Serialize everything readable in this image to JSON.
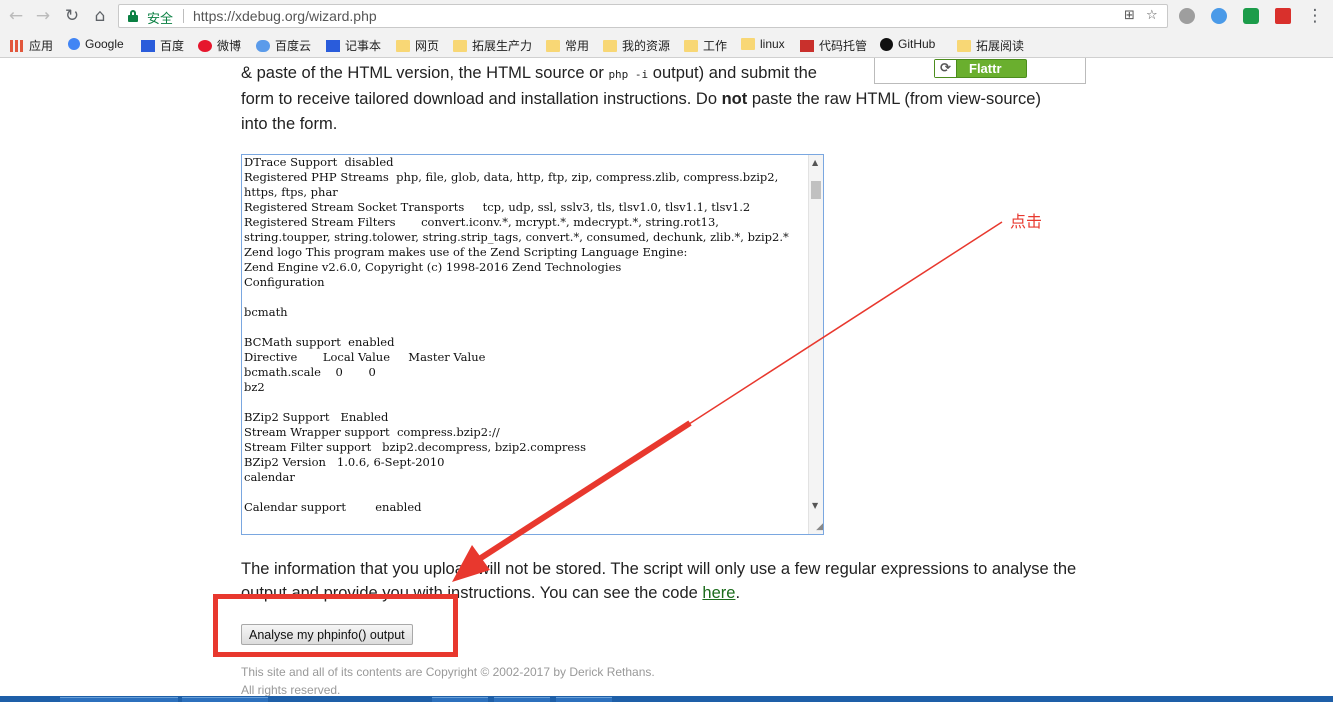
{
  "browser": {
    "secure_label": "安全",
    "url": "https://xdebug.org/wizard.php",
    "bookmarks": [
      "应用",
      "Google",
      "百度",
      "微博",
      "百度云",
      "记事本",
      "网页",
      "拓展生产力",
      "常用",
      "我的资源",
      "工作",
      "linux",
      "代码托管",
      "GitHub",
      "拓展阅读"
    ]
  },
  "page": {
    "intro_line1": "& paste of the HTML version, the HTML source or ",
    "intro_code": "php -i",
    "intro_line1_end": " output) and submit the",
    "intro_line2_pre": "form to receive tailored download and installation instructions. Do ",
    "intro_bold": "not",
    "intro_line2_post": " paste the raw HTML (from view-source)",
    "intro_line3": "into the form.",
    "flattr_label": "Flattr",
    "phpinfo_text": "DTrace Support  disabled\nRegistered PHP Streams  php, file, glob, data, http, ftp, zip, compress.zlib, compress.bzip2, https, ftps, phar\nRegistered Stream Socket Transports     tcp, udp, ssl, sslv3, tls, tlsv1.0, tlsv1.1, tlsv1.2\nRegistered Stream Filters       convert.iconv.*, mcrypt.*, mdecrypt.*, string.rot13, string.toupper, string.tolower, string.strip_tags, convert.*, consumed, dechunk, zlib.*, bzip2.*\nZend logo This program makes use of the Zend Scripting Language Engine:\nZend Engine v2.6.0, Copyright (c) 1998-2016 Zend Technologies\nConfiguration\n\nbcmath\n\nBCMath support  enabled\nDirective       Local Value     Master Value\nbcmath.scale    0       0\nbz2\n\nBZip2 Support   Enabled\nStream Wrapper support  compress.bzip2://\nStream Filter support   bzip2.decompress, bzip2.compress\nBZip2 Version   1.0.6, 6-Sept-2010\ncalendar\n\nCalendar support        enabled",
    "notice_pre": "The information that you upload will not be stored. The script will only use a few regular expressions to analyse the output and provide you with instructions. You can see the code ",
    "notice_link": "here",
    "notice_post": ".",
    "submit_label": "Analyse my phpinfo() output",
    "footer_line1": "This site and all of its contents are Copyright © 2002-2017 by Derick Rethans.",
    "footer_line2": "All rights reserved."
  },
  "annotation": {
    "label": "点击",
    "color": "#e8382e"
  }
}
